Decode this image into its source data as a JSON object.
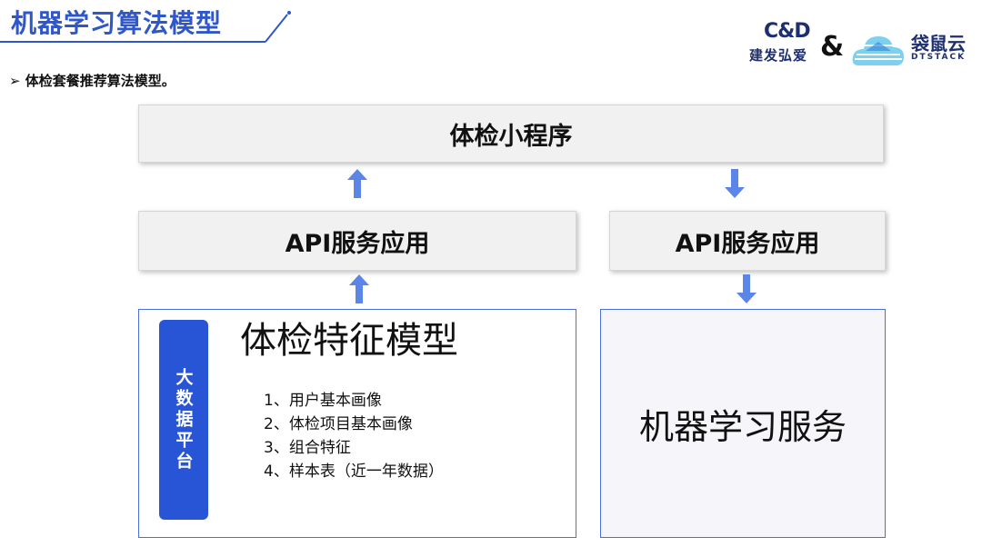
{
  "slide": {
    "title": "机器学习算法模型",
    "subtitle": "➢ 体检套餐推荐算法模型。"
  },
  "logos": {
    "cd_mark": "C&D",
    "cd_name": "建发弘爱",
    "ampersand": "&",
    "dtstack_cn": "袋鼠云",
    "dtstack_en": "DTSTACK"
  },
  "diagram": {
    "top": "体检小程序",
    "api_left": "API服务应用",
    "api_right": "API服务应用",
    "bigdata": "大数据平台",
    "feature_model": {
      "title": "体检特征模型",
      "items": [
        "1、用户基本画像",
        "2、体检项目基本画像",
        "3、组合特征",
        "4、样本表（近一年数据）"
      ]
    },
    "ml_service": "机器学习服务"
  },
  "colors": {
    "title_blue": "#2f57c9",
    "accent_blue": "#2855d6",
    "box_border": "#4a6fd8",
    "arrow_blue": "#5b86e8"
  }
}
